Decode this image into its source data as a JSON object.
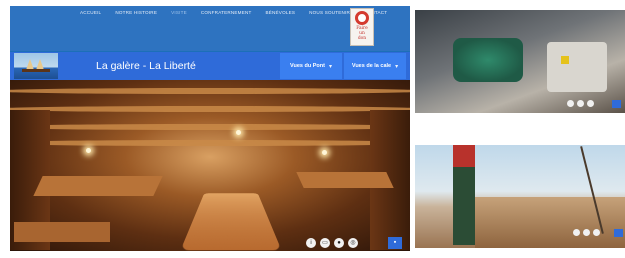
{
  "nav": {
    "items": [
      "ACCUEIL",
      "NOTRE HISTOIRE",
      "VISITE",
      "CONFRATERNEMENT",
      "BÉNÉVOLES",
      "NOUS SOUTENIR",
      "CONTACT"
    ],
    "active_index": 2
  },
  "donate": {
    "line1": "Faire",
    "line2": "un",
    "line3": "don"
  },
  "header": {
    "title": "La galère - La Liberté"
  },
  "views": {
    "deck_label": "Vues du Pont",
    "hold_label": "Vues de la cale"
  },
  "colors": {
    "nav_bg": "#2e73c0",
    "title_bar": "#2f6bd9",
    "button_bg": "#3a7ff0"
  },
  "viewer_controls": [
    "info-icon",
    "share-icon",
    "location-icon",
    "vr-icon",
    "fullscreen-icon"
  ]
}
